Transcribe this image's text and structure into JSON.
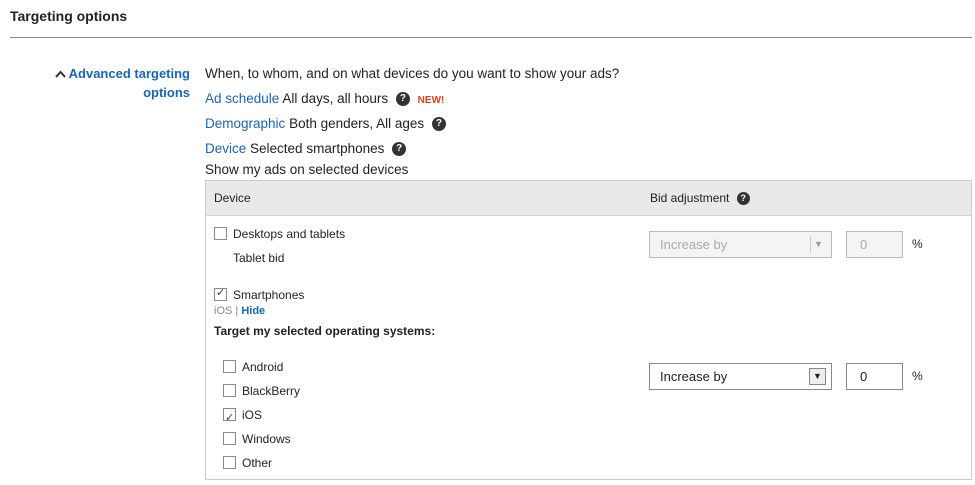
{
  "section": {
    "title": "Targeting options"
  },
  "advanced": {
    "chevron": "^",
    "label_line1": "Advanced targeting",
    "label_line2": "options"
  },
  "intro": "When, to whom, and on what devices do you want to show your ads?",
  "ad_schedule": {
    "link": "Ad schedule",
    "value": "All days, all hours",
    "badge": "NEW!"
  },
  "demographic": {
    "link": "Demographic",
    "value": "Both genders, All ages"
  },
  "device": {
    "link": "Device",
    "value": "Selected smartphones"
  },
  "show_text": "Show my ads on selected devices",
  "help_glyph": "?",
  "table": {
    "col_device": "Device",
    "col_bid": "Bid adjustment",
    "desktops": {
      "label": "Desktops and tablets",
      "checked": false,
      "tablet_bid": "Tablet bid",
      "bid_select": "Increase by",
      "bid_value": "0",
      "unit": "%"
    },
    "smartphones": {
      "label": "Smartphones",
      "checked": true,
      "os_summary": "iOS",
      "separator": "|",
      "hide_link": "Hide",
      "os_heading": "Target my selected operating systems:",
      "os": [
        {
          "label": "Android",
          "checked": false
        },
        {
          "label": "BlackBerry",
          "checked": false
        },
        {
          "label": "iOS",
          "checked": true
        },
        {
          "label": "Windows",
          "checked": false
        },
        {
          "label": "Other",
          "checked": false
        }
      ],
      "bid_select": "Increase by",
      "bid_value": "0",
      "unit": "%"
    }
  }
}
